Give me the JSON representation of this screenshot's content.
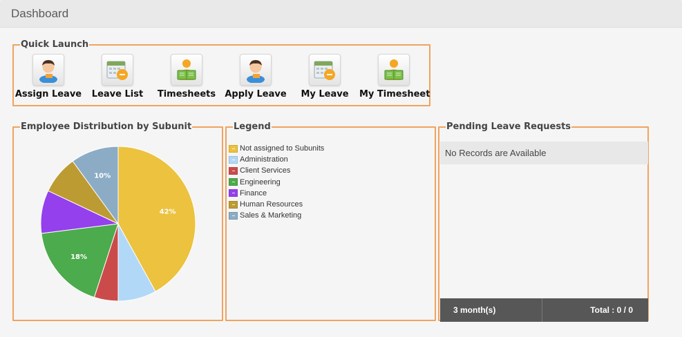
{
  "header": {
    "title": "Dashboard"
  },
  "quick_launch": {
    "title": "Quick Launch",
    "items": [
      {
        "label": "Assign Leave",
        "icon": "person-icon"
      },
      {
        "label": "Leave List",
        "icon": "calendar-icon"
      },
      {
        "label": "Timesheets",
        "icon": "timesheet-icon"
      },
      {
        "label": "Apply Leave",
        "icon": "person-icon"
      },
      {
        "label": "My Leave",
        "icon": "calendar-icon"
      },
      {
        "label": "My Timesheet",
        "icon": "timesheet-icon"
      }
    ]
  },
  "distribution": {
    "title": "Employee Distribution by Subunit"
  },
  "legend": {
    "title": "Legend",
    "items": [
      {
        "label": "Not assigned to Subunits",
        "color": "#ecc23e"
      },
      {
        "label": "Administration",
        "color": "#b2d8f7"
      },
      {
        "label": "Client Services",
        "color": "#cb4b4b"
      },
      {
        "label": "Engineering",
        "color": "#4cab4c"
      },
      {
        "label": "Finance",
        "color": "#9440ed"
      },
      {
        "label": "Human Resources",
        "color": "#bd9b33"
      },
      {
        "label": "Sales & Marketing",
        "color": "#8cacc6"
      }
    ]
  },
  "pending": {
    "title": "Pending Leave Requests",
    "empty_text": "No Records are Available",
    "period": "3 month(s)",
    "total": "Total : 0 / 0"
  },
  "chart_data": {
    "type": "pie",
    "title": "Employee Distribution by Subunit",
    "categories": [
      "Not assigned to Subunits",
      "Administration",
      "Client Services",
      "Engineering",
      "Finance",
      "Human Resources",
      "Sales & Marketing"
    ],
    "values": [
      42,
      8,
      5,
      18,
      9,
      8,
      10
    ],
    "colors": [
      "#ecc23e",
      "#b2d8f7",
      "#cb4b4b",
      "#4cab4c",
      "#9440ed",
      "#bd9b33",
      "#8cacc6"
    ],
    "data_labels": [
      "42%",
      "",
      "",
      "18%",
      "",
      "",
      "10%"
    ],
    "legend": "separate panel"
  }
}
